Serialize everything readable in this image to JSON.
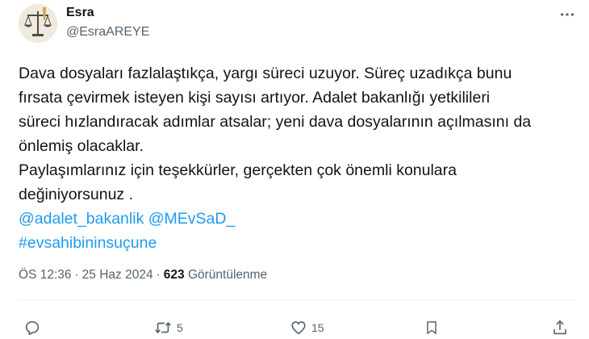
{
  "author": {
    "display_name": "Esra",
    "handle": "@EsraAREYE",
    "avatar_icon": "scales-of-justice-icon"
  },
  "more_icon": "more-horizontal-icon",
  "tweet": {
    "lines": [
      "Dava dosyaları fazlalaştıkça, yargı süreci uzuyor. Süreç uzadıkça bunu",
      "fırsata çevirmek isteyen kişi sayısı artıyor. Adalet bakanlığı yetkilileri",
      "süreci hızlandıracak adımlar atsalar; yeni dava dosyalarının açılmasını da",
      "önlemiş olacaklar.",
      "Paylaşımlarınız için teşekkürler, gerçekten çok önemli konulara",
      "değiniyorsunuz ."
    ],
    "mentions": [
      "@adalet_bakanlik",
      "@MEvSaD_"
    ],
    "hashtag": "#evsahibininsuçune"
  },
  "meta": {
    "time": "ÖS 12:36",
    "separator": "·",
    "date": "25 Haz 2024",
    "views_count": "623",
    "views_label": "Görüntülenme"
  },
  "actions": {
    "reply": {
      "icon": "reply-icon",
      "count": ""
    },
    "retweet": {
      "icon": "retweet-icon",
      "count": "5"
    },
    "like": {
      "icon": "heart-icon",
      "count": "15"
    },
    "bookmark": {
      "icon": "bookmark-icon",
      "count": ""
    },
    "share": {
      "icon": "share-icon",
      "count": ""
    }
  },
  "colors": {
    "text": "#0f1419",
    "secondary": "#536471",
    "link": "#1d9bf0",
    "divider": "#eff3f4"
  }
}
